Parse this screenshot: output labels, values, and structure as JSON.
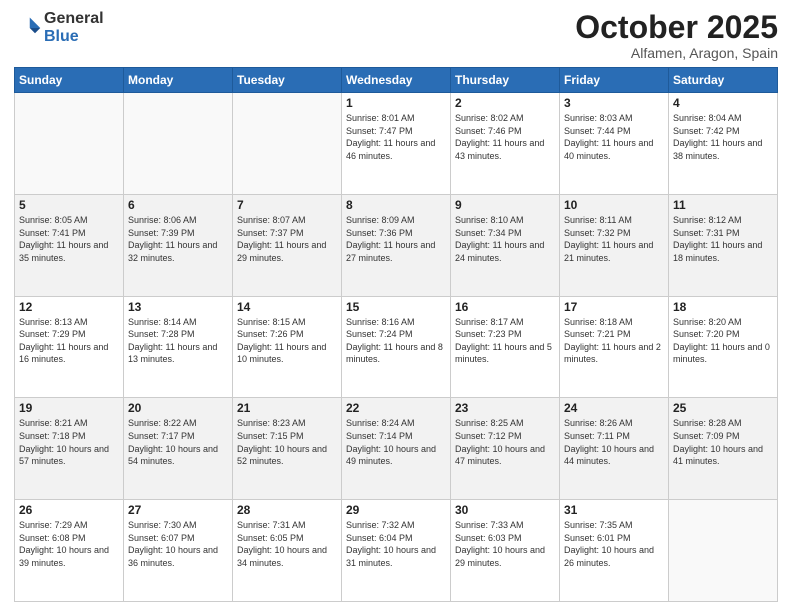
{
  "header": {
    "logo_general": "General",
    "logo_blue": "Blue",
    "month_title": "October 2025",
    "location": "Alfamen, Aragon, Spain"
  },
  "weekdays": [
    "Sunday",
    "Monday",
    "Tuesday",
    "Wednesday",
    "Thursday",
    "Friday",
    "Saturday"
  ],
  "weeks": [
    [
      {
        "day": "",
        "sunrise": "",
        "sunset": "",
        "daylight": ""
      },
      {
        "day": "",
        "sunrise": "",
        "sunset": "",
        "daylight": ""
      },
      {
        "day": "",
        "sunrise": "",
        "sunset": "",
        "daylight": ""
      },
      {
        "day": "1",
        "sunrise": "Sunrise: 8:01 AM",
        "sunset": "Sunset: 7:47 PM",
        "daylight": "Daylight: 11 hours and 46 minutes."
      },
      {
        "day": "2",
        "sunrise": "Sunrise: 8:02 AM",
        "sunset": "Sunset: 7:46 PM",
        "daylight": "Daylight: 11 hours and 43 minutes."
      },
      {
        "day": "3",
        "sunrise": "Sunrise: 8:03 AM",
        "sunset": "Sunset: 7:44 PM",
        "daylight": "Daylight: 11 hours and 40 minutes."
      },
      {
        "day": "4",
        "sunrise": "Sunrise: 8:04 AM",
        "sunset": "Sunset: 7:42 PM",
        "daylight": "Daylight: 11 hours and 38 minutes."
      }
    ],
    [
      {
        "day": "5",
        "sunrise": "Sunrise: 8:05 AM",
        "sunset": "Sunset: 7:41 PM",
        "daylight": "Daylight: 11 hours and 35 minutes."
      },
      {
        "day": "6",
        "sunrise": "Sunrise: 8:06 AM",
        "sunset": "Sunset: 7:39 PM",
        "daylight": "Daylight: 11 hours and 32 minutes."
      },
      {
        "day": "7",
        "sunrise": "Sunrise: 8:07 AM",
        "sunset": "Sunset: 7:37 PM",
        "daylight": "Daylight: 11 hours and 29 minutes."
      },
      {
        "day": "8",
        "sunrise": "Sunrise: 8:09 AM",
        "sunset": "Sunset: 7:36 PM",
        "daylight": "Daylight: 11 hours and 27 minutes."
      },
      {
        "day": "9",
        "sunrise": "Sunrise: 8:10 AM",
        "sunset": "Sunset: 7:34 PM",
        "daylight": "Daylight: 11 hours and 24 minutes."
      },
      {
        "day": "10",
        "sunrise": "Sunrise: 8:11 AM",
        "sunset": "Sunset: 7:32 PM",
        "daylight": "Daylight: 11 hours and 21 minutes."
      },
      {
        "day": "11",
        "sunrise": "Sunrise: 8:12 AM",
        "sunset": "Sunset: 7:31 PM",
        "daylight": "Daylight: 11 hours and 18 minutes."
      }
    ],
    [
      {
        "day": "12",
        "sunrise": "Sunrise: 8:13 AM",
        "sunset": "Sunset: 7:29 PM",
        "daylight": "Daylight: 11 hours and 16 minutes."
      },
      {
        "day": "13",
        "sunrise": "Sunrise: 8:14 AM",
        "sunset": "Sunset: 7:28 PM",
        "daylight": "Daylight: 11 hours and 13 minutes."
      },
      {
        "day": "14",
        "sunrise": "Sunrise: 8:15 AM",
        "sunset": "Sunset: 7:26 PM",
        "daylight": "Daylight: 11 hours and 10 minutes."
      },
      {
        "day": "15",
        "sunrise": "Sunrise: 8:16 AM",
        "sunset": "Sunset: 7:24 PM",
        "daylight": "Daylight: 11 hours and 8 minutes."
      },
      {
        "day": "16",
        "sunrise": "Sunrise: 8:17 AM",
        "sunset": "Sunset: 7:23 PM",
        "daylight": "Daylight: 11 hours and 5 minutes."
      },
      {
        "day": "17",
        "sunrise": "Sunrise: 8:18 AM",
        "sunset": "Sunset: 7:21 PM",
        "daylight": "Daylight: 11 hours and 2 minutes."
      },
      {
        "day": "18",
        "sunrise": "Sunrise: 8:20 AM",
        "sunset": "Sunset: 7:20 PM",
        "daylight": "Daylight: 11 hours and 0 minutes."
      }
    ],
    [
      {
        "day": "19",
        "sunrise": "Sunrise: 8:21 AM",
        "sunset": "Sunset: 7:18 PM",
        "daylight": "Daylight: 10 hours and 57 minutes."
      },
      {
        "day": "20",
        "sunrise": "Sunrise: 8:22 AM",
        "sunset": "Sunset: 7:17 PM",
        "daylight": "Daylight: 10 hours and 54 minutes."
      },
      {
        "day": "21",
        "sunrise": "Sunrise: 8:23 AM",
        "sunset": "Sunset: 7:15 PM",
        "daylight": "Daylight: 10 hours and 52 minutes."
      },
      {
        "day": "22",
        "sunrise": "Sunrise: 8:24 AM",
        "sunset": "Sunset: 7:14 PM",
        "daylight": "Daylight: 10 hours and 49 minutes."
      },
      {
        "day": "23",
        "sunrise": "Sunrise: 8:25 AM",
        "sunset": "Sunset: 7:12 PM",
        "daylight": "Daylight: 10 hours and 47 minutes."
      },
      {
        "day": "24",
        "sunrise": "Sunrise: 8:26 AM",
        "sunset": "Sunset: 7:11 PM",
        "daylight": "Daylight: 10 hours and 44 minutes."
      },
      {
        "day": "25",
        "sunrise": "Sunrise: 8:28 AM",
        "sunset": "Sunset: 7:09 PM",
        "daylight": "Daylight: 10 hours and 41 minutes."
      }
    ],
    [
      {
        "day": "26",
        "sunrise": "Sunrise: 7:29 AM",
        "sunset": "Sunset: 6:08 PM",
        "daylight": "Daylight: 10 hours and 39 minutes."
      },
      {
        "day": "27",
        "sunrise": "Sunrise: 7:30 AM",
        "sunset": "Sunset: 6:07 PM",
        "daylight": "Daylight: 10 hours and 36 minutes."
      },
      {
        "day": "28",
        "sunrise": "Sunrise: 7:31 AM",
        "sunset": "Sunset: 6:05 PM",
        "daylight": "Daylight: 10 hours and 34 minutes."
      },
      {
        "day": "29",
        "sunrise": "Sunrise: 7:32 AM",
        "sunset": "Sunset: 6:04 PM",
        "daylight": "Daylight: 10 hours and 31 minutes."
      },
      {
        "day": "30",
        "sunrise": "Sunrise: 7:33 AM",
        "sunset": "Sunset: 6:03 PM",
        "daylight": "Daylight: 10 hours and 29 minutes."
      },
      {
        "day": "31",
        "sunrise": "Sunrise: 7:35 AM",
        "sunset": "Sunset: 6:01 PM",
        "daylight": "Daylight: 10 hours and 26 minutes."
      },
      {
        "day": "",
        "sunrise": "",
        "sunset": "",
        "daylight": ""
      }
    ]
  ]
}
